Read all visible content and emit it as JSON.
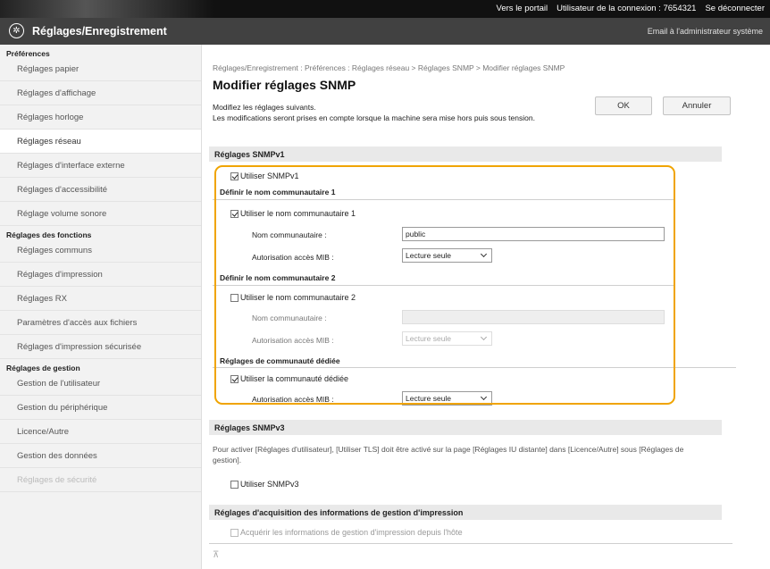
{
  "topbar": {
    "portal_link": "Vers le portail",
    "login_user_label": "Utilisateur de la connexion :",
    "login_user_id": "7654321",
    "logout_link": "Se déconnecter"
  },
  "header": {
    "title": "Réglages/Enregistrement",
    "admin_mail_link": "Email à l'administrateur système"
  },
  "sidebar": {
    "groups": [
      {
        "label": "Préférences",
        "items": [
          "Réglages papier",
          "Réglages d'affichage",
          "Réglages horloge",
          "Réglages réseau",
          "Réglages d'interface externe",
          "Réglages d'accessibilité",
          "Réglage volume sonore"
        ]
      },
      {
        "label": "Réglages des fonctions",
        "items": [
          "Réglages communs",
          "Réglages d'impression",
          "Réglages RX",
          "Paramètres d'accès aux fichiers",
          "Réglages d'impression sécurisée"
        ]
      },
      {
        "label": "Réglages de gestion",
        "items": [
          "Gestion de l'utilisateur",
          "Gestion du périphérique",
          "Licence/Autre",
          "Gestion des données",
          "Réglages de sécurité"
        ]
      }
    ],
    "active_item": "Réglages réseau"
  },
  "main": {
    "breadcrumb": "Réglages/Enregistrement : Préférences : Réglages réseau > Réglages SNMP > Modifier réglages SNMP",
    "title": "Modifier réglages SNMP",
    "description_line1": "Modifiez les réglages suivants.",
    "description_line2": "Les modifications seront prises en compte lorsque la machine sera mise hors puis sous tension.",
    "ok_label": "OK",
    "cancel_label": "Annuler",
    "snmpv1": {
      "header": "Réglages SNMPv1",
      "use_label": "Utiliser SNMPv1",
      "community1": {
        "subheader": "Définir le nom communautaire 1",
        "use_label": "Utiliser le nom communautaire 1",
        "name_label": "Nom communautaire :",
        "name_value": "public",
        "mib_label": "Autorisation accès MIB :",
        "mib_value": "Lecture seule"
      },
      "community2": {
        "subheader": "Définir le nom communautaire 2",
        "use_label": "Utiliser le nom communautaire 2",
        "name_label": "Nom communautaire :",
        "name_value": "",
        "mib_label": "Autorisation accès MIB :",
        "mib_value": "Lecture seule"
      },
      "dedicated": {
        "subheader": "Réglages de communauté dédiée",
        "use_label": "Utiliser la communauté dédiée",
        "mib_label": "Autorisation accès MIB :",
        "mib_value": "Lecture seule"
      }
    },
    "snmpv3": {
      "header": "Réglages SNMPv3",
      "info": "Pour activer [Réglages d'utilisateur], [Utiliser TLS] doit être activé sur la page [Réglages IU distante] dans [Licence/Autre] sous [Réglages de gestion].",
      "use_label": "Utiliser SNMPv3"
    },
    "acquisition": {
      "header": "Réglages d'acquisition des informations de gestion d'impression",
      "use_label": "Acquérir les informations de gestion d'impression depuis l'hôte"
    },
    "footer_mark": "⊼"
  },
  "colors": {
    "highlight": "#f0a400",
    "header_bg": "#414141",
    "topbar_bg": "#111111"
  }
}
